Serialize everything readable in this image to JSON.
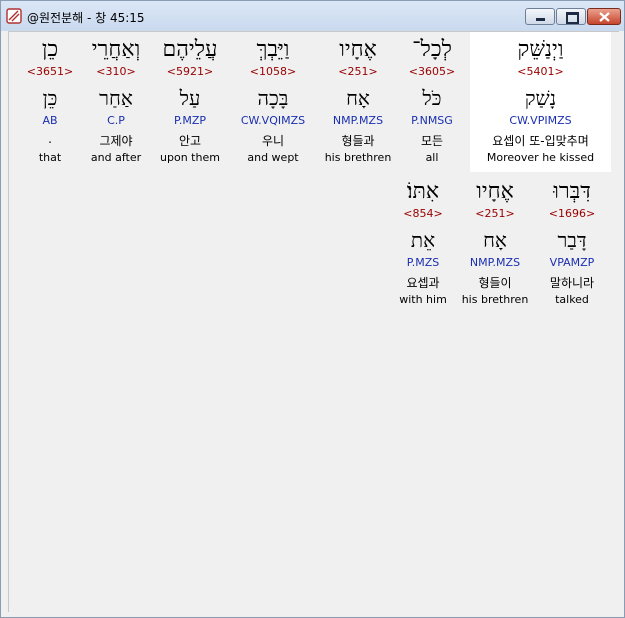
{
  "window": {
    "title": "@원전분해 - 창 45:15"
  },
  "row1": [
    {
      "hebrew": "כֵן",
      "strong": "<3651>",
      "lemma": "כֵּן",
      "morph": "AB",
      "korean": ".",
      "english": "that"
    },
    {
      "hebrew": "וְאַחֲרֵי",
      "strong": "<310>",
      "lemma": "אַחַר",
      "morph": "C.P",
      "korean": "그제야",
      "english": "and after"
    },
    {
      "hebrew": "עֲלֵיהֶם",
      "strong": "<5921>",
      "lemma": "עַל",
      "morph": "P.MZP",
      "korean": "안고",
      "english": "upon them"
    },
    {
      "hebrew": "וַיֵּבְךְּ",
      "strong": "<1058>",
      "lemma": "בָּכָה",
      "morph": "CW.VQIMZS",
      "korean": "우니",
      "english": "and wept"
    },
    {
      "hebrew": "אֶחָיו",
      "strong": "<251>",
      "lemma": "אָח",
      "morph": "NMP.MZS",
      "korean": "형들과",
      "english": "his brethren"
    },
    {
      "hebrew": "לְכָל־",
      "strong": "<3605>",
      "lemma": "כֹּל",
      "morph": "P.NMSG",
      "korean": "모든",
      "english": "all"
    },
    {
      "hebrew": "וַיְנַשֵּׁק",
      "strong": "<5401>",
      "lemma": "נָשַׁק",
      "morph": "CW.VPIMZS",
      "korean": "요셉이 또-입맞추며",
      "english": "Moreover he kissed"
    }
  ],
  "row2": [
    {
      "hebrew": "אִתּוֹ׃",
      "strong": "<854>",
      "lemma": "אֵת",
      "morph": "P.MZS",
      "korean": "요셉과",
      "english": "with him"
    },
    {
      "hebrew": "אֶחָיו",
      "strong": "<251>",
      "lemma": "אָח",
      "morph": "NMP.MZS",
      "korean": "형들이",
      "english": "his brethren"
    },
    {
      "hebrew": "דִּבְּרוּ",
      "strong": "<1696>",
      "lemma": "דָּבַר",
      "morph": "VPAMZP",
      "korean": "말하니라",
      "english": "talked"
    }
  ]
}
